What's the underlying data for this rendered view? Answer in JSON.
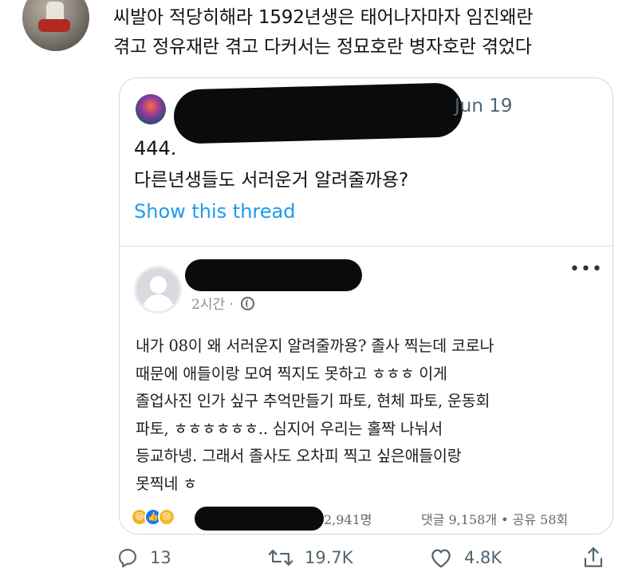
{
  "tweet": {
    "text_line1": "씨발아 적당히해라 1592년생은 태어나자마자 임진왜란",
    "text_line2": "겪고 정유재란 겪고 다커서는 정묘호란 병자호란 겪었다"
  },
  "quote": {
    "date": "Jun 19",
    "line1": "444.",
    "line2": "다른년생들도 서러운거 알려줄까용?",
    "show_thread": "Show this thread"
  },
  "fb_post": {
    "time": "2시간",
    "separator": "·",
    "body": [
      "내가 08이 왜 서러운지 알려줄까용? 졸사 찍는데 코로나",
      "때문에 애들이랑 모여 찍지도 못하고 ㅎㅎㅎ 이게",
      "졸업사진 인가 싶구 추억만들기 파토, 현체 파토, 운동회",
      "파토, ㅎㅎㅎㅎㅎㅎ.. 심지어 우리는 홀짝 나눠서",
      "등교하넹. 그래서 졸사도 오차피 찍고 싶은애들이랑",
      "못찍네 ㅎ"
    ],
    "reaction_count": "2,941명",
    "comments_shares": "댓글 9,158개  •  공유 58회"
  },
  "actions": {
    "reply_count": "13",
    "retweet_count": "19.7K",
    "like_count": "4.8K"
  }
}
